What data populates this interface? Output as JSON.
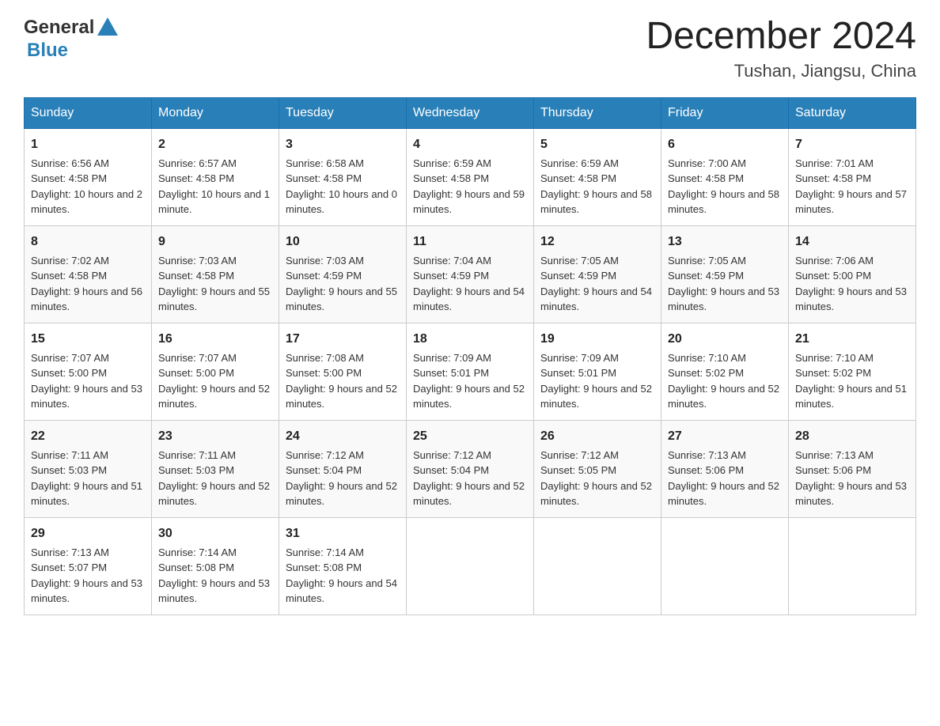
{
  "header": {
    "logo_general": "General",
    "logo_blue": "Blue",
    "month_title": "December 2024",
    "location": "Tushan, Jiangsu, China"
  },
  "days_of_week": [
    "Sunday",
    "Monday",
    "Tuesday",
    "Wednesday",
    "Thursday",
    "Friday",
    "Saturday"
  ],
  "weeks": [
    [
      {
        "day": "1",
        "sunrise": "6:56 AM",
        "sunset": "4:58 PM",
        "daylight": "10 hours and 2 minutes."
      },
      {
        "day": "2",
        "sunrise": "6:57 AM",
        "sunset": "4:58 PM",
        "daylight": "10 hours and 1 minute."
      },
      {
        "day": "3",
        "sunrise": "6:58 AM",
        "sunset": "4:58 PM",
        "daylight": "10 hours and 0 minutes."
      },
      {
        "day": "4",
        "sunrise": "6:59 AM",
        "sunset": "4:58 PM",
        "daylight": "9 hours and 59 minutes."
      },
      {
        "day": "5",
        "sunrise": "6:59 AM",
        "sunset": "4:58 PM",
        "daylight": "9 hours and 58 minutes."
      },
      {
        "day": "6",
        "sunrise": "7:00 AM",
        "sunset": "4:58 PM",
        "daylight": "9 hours and 58 minutes."
      },
      {
        "day": "7",
        "sunrise": "7:01 AM",
        "sunset": "4:58 PM",
        "daylight": "9 hours and 57 minutes."
      }
    ],
    [
      {
        "day": "8",
        "sunrise": "7:02 AM",
        "sunset": "4:58 PM",
        "daylight": "9 hours and 56 minutes."
      },
      {
        "day": "9",
        "sunrise": "7:03 AM",
        "sunset": "4:58 PM",
        "daylight": "9 hours and 55 minutes."
      },
      {
        "day": "10",
        "sunrise": "7:03 AM",
        "sunset": "4:59 PM",
        "daylight": "9 hours and 55 minutes."
      },
      {
        "day": "11",
        "sunrise": "7:04 AM",
        "sunset": "4:59 PM",
        "daylight": "9 hours and 54 minutes."
      },
      {
        "day": "12",
        "sunrise": "7:05 AM",
        "sunset": "4:59 PM",
        "daylight": "9 hours and 54 minutes."
      },
      {
        "day": "13",
        "sunrise": "7:05 AM",
        "sunset": "4:59 PM",
        "daylight": "9 hours and 53 minutes."
      },
      {
        "day": "14",
        "sunrise": "7:06 AM",
        "sunset": "5:00 PM",
        "daylight": "9 hours and 53 minutes."
      }
    ],
    [
      {
        "day": "15",
        "sunrise": "7:07 AM",
        "sunset": "5:00 PM",
        "daylight": "9 hours and 53 minutes."
      },
      {
        "day": "16",
        "sunrise": "7:07 AM",
        "sunset": "5:00 PM",
        "daylight": "9 hours and 52 minutes."
      },
      {
        "day": "17",
        "sunrise": "7:08 AM",
        "sunset": "5:00 PM",
        "daylight": "9 hours and 52 minutes."
      },
      {
        "day": "18",
        "sunrise": "7:09 AM",
        "sunset": "5:01 PM",
        "daylight": "9 hours and 52 minutes."
      },
      {
        "day": "19",
        "sunrise": "7:09 AM",
        "sunset": "5:01 PM",
        "daylight": "9 hours and 52 minutes."
      },
      {
        "day": "20",
        "sunrise": "7:10 AM",
        "sunset": "5:02 PM",
        "daylight": "9 hours and 52 minutes."
      },
      {
        "day": "21",
        "sunrise": "7:10 AM",
        "sunset": "5:02 PM",
        "daylight": "9 hours and 51 minutes."
      }
    ],
    [
      {
        "day": "22",
        "sunrise": "7:11 AM",
        "sunset": "5:03 PM",
        "daylight": "9 hours and 51 minutes."
      },
      {
        "day": "23",
        "sunrise": "7:11 AM",
        "sunset": "5:03 PM",
        "daylight": "9 hours and 52 minutes."
      },
      {
        "day": "24",
        "sunrise": "7:12 AM",
        "sunset": "5:04 PM",
        "daylight": "9 hours and 52 minutes."
      },
      {
        "day": "25",
        "sunrise": "7:12 AM",
        "sunset": "5:04 PM",
        "daylight": "9 hours and 52 minutes."
      },
      {
        "day": "26",
        "sunrise": "7:12 AM",
        "sunset": "5:05 PM",
        "daylight": "9 hours and 52 minutes."
      },
      {
        "day": "27",
        "sunrise": "7:13 AM",
        "sunset": "5:06 PM",
        "daylight": "9 hours and 52 minutes."
      },
      {
        "day": "28",
        "sunrise": "7:13 AM",
        "sunset": "5:06 PM",
        "daylight": "9 hours and 53 minutes."
      }
    ],
    [
      {
        "day": "29",
        "sunrise": "7:13 AM",
        "sunset": "5:07 PM",
        "daylight": "9 hours and 53 minutes."
      },
      {
        "day": "30",
        "sunrise": "7:14 AM",
        "sunset": "5:08 PM",
        "daylight": "9 hours and 53 minutes."
      },
      {
        "day": "31",
        "sunrise": "7:14 AM",
        "sunset": "5:08 PM",
        "daylight": "9 hours and 54 minutes."
      },
      null,
      null,
      null,
      null
    ]
  ]
}
